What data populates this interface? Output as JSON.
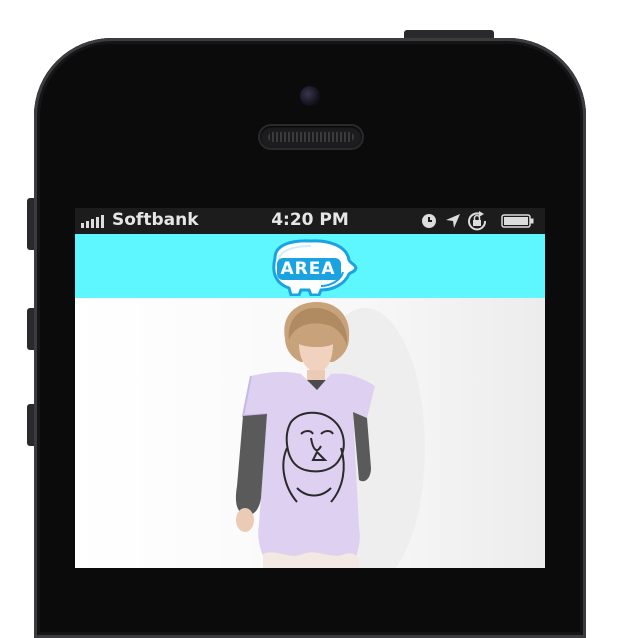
{
  "status_bar": {
    "carrier": "Softbank",
    "time": "4:20 PM",
    "icons": [
      "signal-icon",
      "alarm-clock-icon",
      "location-arrow-icon",
      "rotation-lock-icon",
      "battery-icon"
    ]
  },
  "app_header": {
    "logo_text": "AREA",
    "color": "#5ef7ff"
  },
  "content": {
    "image": "product-photo"
  },
  "colors": {
    "header_bg": "#5ef7ff",
    "logo_blue": "#1aa3e0",
    "status_bar_bg": "#1c1c1c"
  }
}
